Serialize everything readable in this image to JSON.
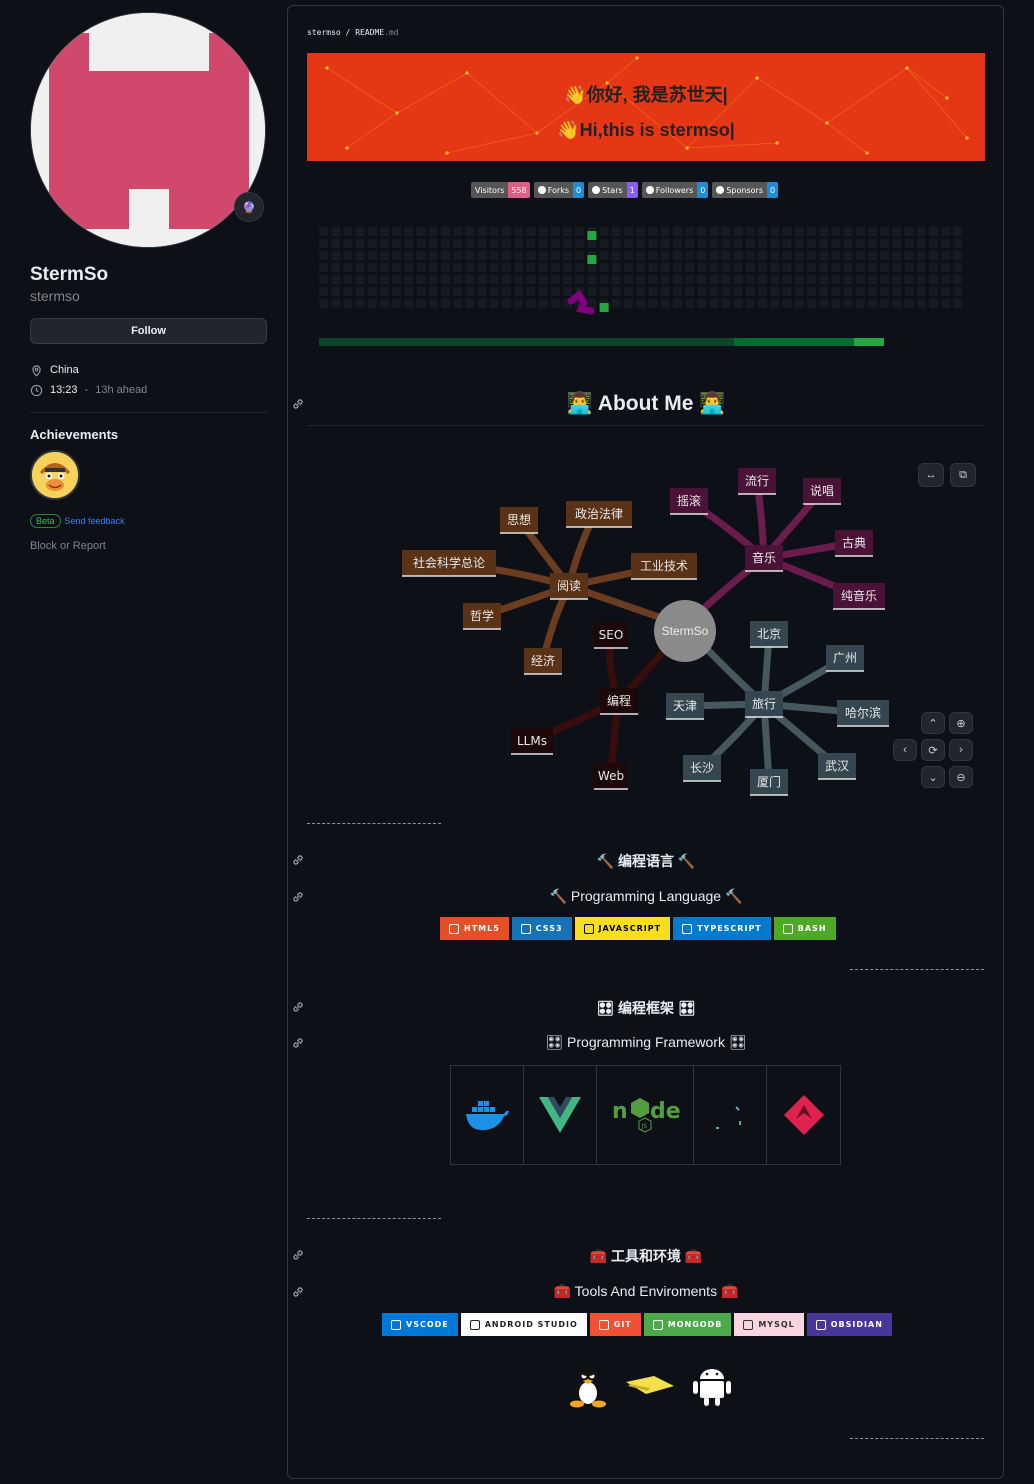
{
  "profile": {
    "fullname": "StermSo",
    "login": "stermso",
    "follow_label": "Follow",
    "location": "China",
    "local_time": "13:23",
    "time_sep": "-",
    "time_offset": "13h ahead",
    "achievements_title": "Achievements",
    "beta_label": "Beta",
    "feedback_label": "Send feedback",
    "block_label": "Block or Report"
  },
  "readme": {
    "breadcrumb_user": "stermso",
    "breadcrumb_sep": "/",
    "breadcrumb_file": "README",
    "breadcrumb_ext": ".md",
    "banner_line1": "👋你好, 我是苏世天|",
    "banner_line2": "👋Hi,this is stermso|",
    "shields": [
      {
        "label": "Visitors",
        "value": "558",
        "color": "#e05d84",
        "icon": ""
      },
      {
        "label": "Forks",
        "value": "0",
        "color": "#1f8dd6",
        "icon": "github-icon"
      },
      {
        "label": "Stars",
        "value": "1",
        "color": "#8a5cf6",
        "icon": "github-icon"
      },
      {
        "label": "Followers",
        "value": "0",
        "color": "#1f8dd6",
        "icon": "github-icon"
      },
      {
        "label": "Sponsors",
        "value": "0",
        "color": "#1f8dd6",
        "icon": "github-icon"
      }
    ],
    "about_title": "👨‍💻 About Me 👨‍💻",
    "mindmap": {
      "center": "StermSo",
      "nodes": [
        "阅读",
        "思想",
        "政治法律",
        "社会科学总论",
        "工业技术",
        "哲学",
        "经济",
        "音乐",
        "摇滚",
        "流行",
        "说唱",
        "古典",
        "纯音乐",
        "旅行",
        "北京",
        "广州",
        "哈尔滨",
        "武汉",
        "厦门",
        "长沙",
        "天津",
        "编程",
        "SEO",
        "LLMs",
        "Web"
      ]
    },
    "lang_title_cn": "🔨 编程语言 🔨",
    "lang_title_en": "🔨 Programming Language 🔨",
    "langs": [
      {
        "label": "HTML5",
        "bg": "#e34f26",
        "fg": "#ffffff",
        "icon": "html5-icon"
      },
      {
        "label": "CSS3",
        "bg": "#1572b6",
        "fg": "#ffffff",
        "icon": "css3-icon"
      },
      {
        "label": "JAVASCRIPT",
        "bg": "#f7df1e",
        "fg": "#000000",
        "icon": "javascript-icon"
      },
      {
        "label": "TYPESCRIPT",
        "bg": "#007acc",
        "fg": "#ffffff",
        "icon": "typescript-icon"
      },
      {
        "label": "BASH",
        "bg": "#4eaa25",
        "fg": "#ffffff",
        "icon": "bash-icon"
      }
    ],
    "fw_title_cn": "🎛 编程框架 🎛",
    "fw_title_en": "🎛 Programming Framework 🎛",
    "frameworks": [
      "docker-logo",
      "vue-logo",
      "nodejs-logo",
      "react-logo",
      "nestjs-logo"
    ],
    "tools_title_cn": "🧰 工具和环境 🧰",
    "tools_title_en": "🧰 Tools And Enviroments 🧰",
    "tools": [
      {
        "label": "VSCODE",
        "bg": "#0078d7",
        "fg": "#ffffff",
        "icon": "vscode-icon"
      },
      {
        "label": "ANDROID STUDIO",
        "bg": "#ffffff",
        "fg": "#222222",
        "icon": "android-studio-icon"
      },
      {
        "label": "GIT",
        "bg": "#f05033",
        "fg": "#ffffff",
        "icon": "git-icon"
      },
      {
        "label": "MONGODB",
        "bg": "#4ea94b",
        "fg": "#ffffff",
        "icon": "mongodb-icon"
      },
      {
        "label": "MYSQL",
        "bg": "#f8d5e0",
        "fg": "#333333",
        "icon": "mysql-icon"
      },
      {
        "label": "OBSIDIAN",
        "bg": "#483699",
        "fg": "#ffffff",
        "icon": "obsidian-icon"
      }
    ],
    "os_icons": [
      "linux-icon",
      "arch-icon",
      "android-icon"
    ]
  }
}
